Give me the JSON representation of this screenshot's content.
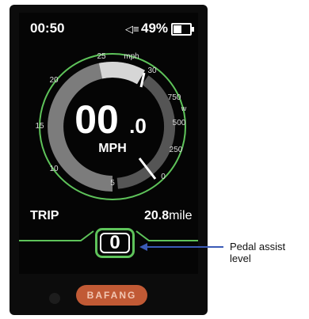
{
  "status": {
    "time": "00:50",
    "headlight_icon": "headlight-icon",
    "battery_percent": "49%",
    "battery_level": 0.49
  },
  "gauge": {
    "speed_integer": "00",
    "speed_decimal": ".0",
    "unit": "MPH",
    "speed_unit_label": "mph",
    "power_unit_label": "w",
    "speed_ticks": [
      "0",
      "5",
      "10",
      "15",
      "20",
      "25",
      "30"
    ],
    "power_ticks": [
      "0",
      "250",
      "500",
      "750"
    ]
  },
  "trip": {
    "label": "TRIP",
    "value": "20.8",
    "unit": "mile"
  },
  "assist": {
    "level": "0"
  },
  "brand": {
    "logo_text": "BAFANG"
  },
  "annotation": {
    "label": "Pedal assist level",
    "arrow_color": "#3b5bb7"
  },
  "colors": {
    "accent_green": "#5ec35a",
    "brand_orange": "#c15a35"
  }
}
